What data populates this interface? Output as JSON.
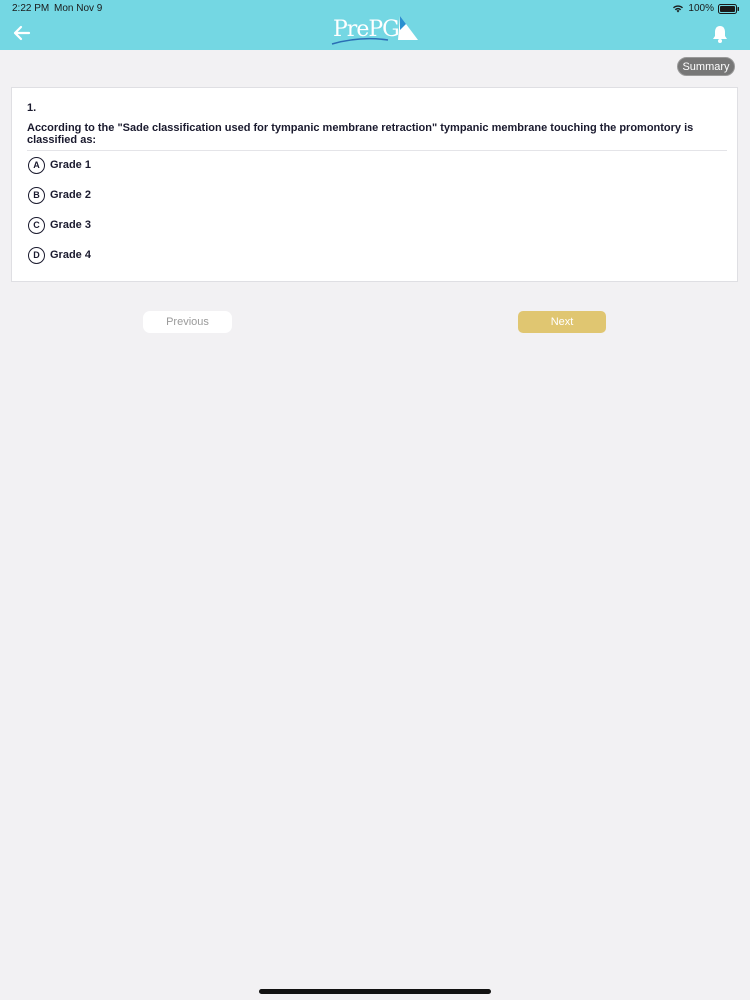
{
  "status_bar": {
    "time": "2:22 PM",
    "date": "Mon Nov 9",
    "battery": "100%"
  },
  "header": {
    "logo_text": "PrePG",
    "background_color": "#74d7e3",
    "icons": [
      "back-arrow-icon",
      "bell-icon"
    ]
  },
  "summary_label": "Summary",
  "question": {
    "number": "1.",
    "text": "According to the \"Sade classification used for tympanic membrane retraction\" tympanic membrane touching the promontory is classified as:",
    "options": [
      {
        "letter": "A",
        "label": "Grade 1"
      },
      {
        "letter": "B",
        "label": "Grade 2"
      },
      {
        "letter": "C",
        "label": "Grade 3"
      },
      {
        "letter": "D",
        "label": "Grade 4"
      }
    ]
  },
  "navigation": {
    "previous_label": "Previous",
    "next_label": "Next",
    "next_color": "#e0c671"
  }
}
